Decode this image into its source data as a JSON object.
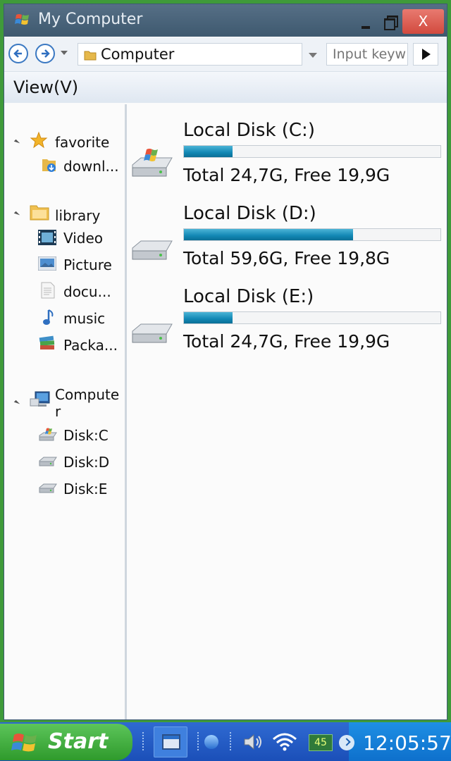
{
  "window": {
    "title": "My Computer",
    "close_label": "X"
  },
  "navbar": {
    "address": "Computer",
    "search_placeholder": "Input keyw"
  },
  "menubar": {
    "view_label": "View(V)"
  },
  "sidebar": {
    "favorite": {
      "label": "favorite",
      "items": [
        {
          "label": "downl..."
        }
      ]
    },
    "library": {
      "label": "library",
      "items": [
        {
          "label": "Video"
        },
        {
          "label": "Picture"
        },
        {
          "label": "docu..."
        },
        {
          "label": "music"
        },
        {
          "label": "Packa..."
        }
      ]
    },
    "computer": {
      "label_line1": "Compute",
      "label_line2": "r",
      "items": [
        {
          "label": "Disk:C"
        },
        {
          "label": "Disk:D"
        },
        {
          "label": "Disk:E"
        }
      ]
    }
  },
  "disks": [
    {
      "name": "Local Disk (C:)",
      "info": "Total 24,7G, Free 19,9G",
      "used_fraction": 0.19
    },
    {
      "name": "Local Disk (D:)",
      "info": "Total 59,6G, Free 19,8G",
      "used_fraction": 0.66
    },
    {
      "name": "Local Disk (E:)",
      "info": "Total 24,7G, Free 19,9G",
      "used_fraction": 0.19
    }
  ],
  "taskbar": {
    "start_label": "Start",
    "battery": "45",
    "clock": "12:05:57"
  }
}
